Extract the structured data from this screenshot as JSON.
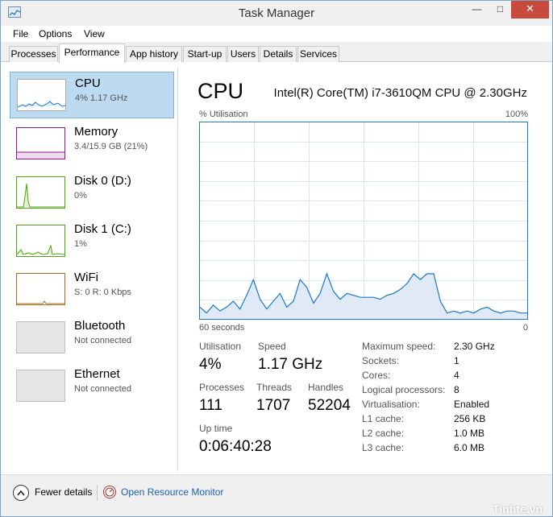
{
  "window": {
    "title": "Task Manager"
  },
  "menu": [
    "File",
    "Options",
    "View"
  ],
  "tabs": [
    "Processes",
    "Performance",
    "App history",
    "Start-up",
    "Users",
    "Details",
    "Services"
  ],
  "sidebar": {
    "items": [
      {
        "name": "CPU",
        "sub": "4% 1.17 GHz",
        "color": "#1979ca"
      },
      {
        "name": "Memory",
        "sub": "3.4/15.9 GB (21%)",
        "color": "#8b1a8b"
      },
      {
        "name": "Disk 0 (D:)",
        "sub": "0%",
        "color": "#4da60c"
      },
      {
        "name": "Disk 1 (C:)",
        "sub": "1%",
        "color": "#4da60c"
      },
      {
        "name": "WiFi",
        "sub": "S: 0 R: 0 Kbps",
        "color": "#a86d1e"
      },
      {
        "name": "Bluetooth",
        "sub": "Not connected",
        "color": "#bdbdbd"
      },
      {
        "name": "Ethernet",
        "sub": "Not connected",
        "color": "#bdbdbd"
      }
    ]
  },
  "main": {
    "title": "CPU",
    "model": "Intel(R) Core(TM) i7-3610QM CPU @ 2.30GHz",
    "chart_label_left": "% Utilisation",
    "chart_label_right": "100%",
    "chart_label_bottom_left": "60 seconds",
    "chart_label_bottom_right": "0"
  },
  "chart_data": {
    "type": "area",
    "ylabel": "% Utilisation",
    "ylim": [
      0,
      100
    ],
    "x_span_seconds": 60,
    "grid": true,
    "color": "#1979ca",
    "values": [
      6,
      3,
      7,
      4,
      6,
      9,
      5,
      12,
      20,
      10,
      5,
      9,
      13,
      6,
      9,
      20,
      16,
      8,
      13,
      23,
      14,
      10,
      13,
      12,
      11,
      11,
      11,
      10,
      12,
      13,
      15,
      18,
      23,
      20,
      23,
      23,
      9,
      3,
      4,
      3,
      4,
      3,
      5,
      6,
      4,
      3,
      4,
      4,
      3,
      3
    ]
  },
  "stats": {
    "utilisation_label": "Utilisation",
    "utilisation": "4%",
    "speed_label": "Speed",
    "speed": "1.17 GHz",
    "processes_label": "Processes",
    "processes": "111",
    "threads_label": "Threads",
    "threads": "1707",
    "handles_label": "Handles",
    "handles": "52204",
    "uptime_label": "Up time",
    "uptime": "0:06:40:28"
  },
  "specs": [
    {
      "label": "Maximum speed:",
      "value": "2.30 GHz"
    },
    {
      "label": "Sockets:",
      "value": "1"
    },
    {
      "label": "Cores:",
      "value": "4"
    },
    {
      "label": "Logical processors:",
      "value": "8"
    },
    {
      "label": "Virtualisation:",
      "value": "Enabled"
    },
    {
      "label": "L1 cache:",
      "value": "256 KB"
    },
    {
      "label": "L2 cache:",
      "value": "1.0 MB"
    },
    {
      "label": "L3 cache:",
      "value": "6.0 MB"
    }
  ],
  "footer": {
    "fewer": "Fewer details",
    "resource": "Open Resource Monitor"
  },
  "watermark": "Tinhte.vn"
}
